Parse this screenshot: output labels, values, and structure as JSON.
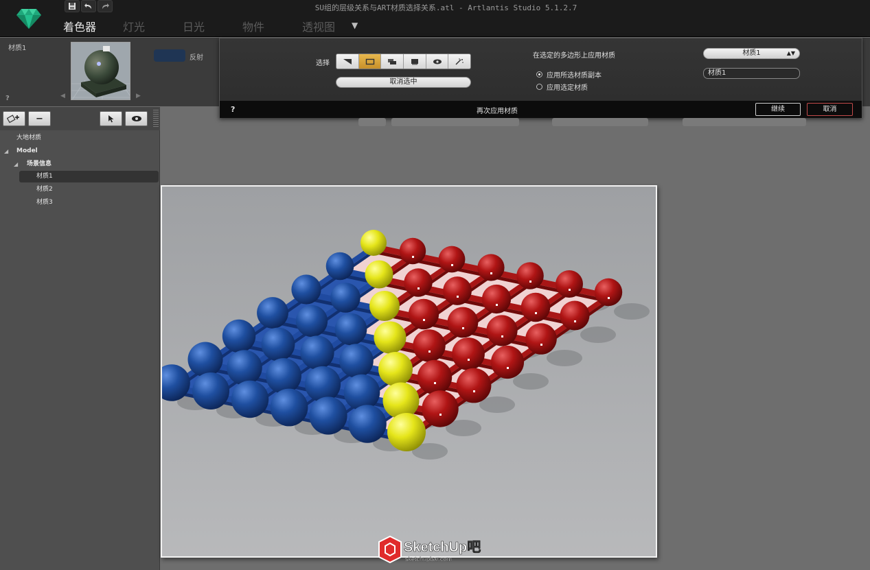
{
  "app": {
    "window_title": "SU组的层级关系与ART材质选择关系.atl - Artlantis Studio 5.1.2.7",
    "tabs": [
      "着色器",
      "灯光",
      "日光",
      "物件",
      "透视图"
    ],
    "active_tab": "着色器"
  },
  "material_strip": {
    "name": "材质1",
    "reflect_label": "反射",
    "help": "?"
  },
  "dialog": {
    "select_label": "选择",
    "deselect_label": "取消选中",
    "apply_title": "在选定的多边形上应用材质",
    "radio_copy": "应用所选材质副本",
    "radio_selected": "应用选定材质",
    "material_select_value": "材质1",
    "material_name_value": "材质1",
    "help": "?",
    "reapply_label": "再次应用材质",
    "ok_label": "继续",
    "cancel_label": "取消",
    "selected_tool_index": 1
  },
  "tree": {
    "root_label": "大地材质",
    "model_label": "Model",
    "group_label": "场景信息",
    "items": [
      "材质1",
      "材质2",
      "材质3"
    ],
    "selected_index": 0
  },
  "watermark": {
    "brand": "SketchUp吧",
    "url": "sketchupbar.com"
  },
  "colors": {
    "accent_gold": "#d6a23b",
    "cancel_border": "#c24a4a",
    "blue_material": "#1f4fa0",
    "red_material": "#b01515",
    "yellow_material": "#e5e51a"
  }
}
